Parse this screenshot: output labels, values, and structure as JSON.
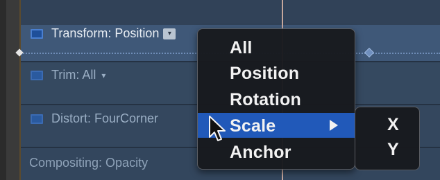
{
  "tracks": {
    "transform": {
      "label": "Transform: Position",
      "arrow": "▾"
    },
    "trim": {
      "label": "Trim: All",
      "arrow": "▾"
    },
    "distort": {
      "label": "Distort: FourCorner"
    },
    "compositing": {
      "label": "Compositing: Opacity"
    }
  },
  "menu": {
    "items": [
      {
        "label": "All"
      },
      {
        "label": "Position"
      },
      {
        "label": "Rotation"
      },
      {
        "label": "Scale",
        "highlighted": true,
        "has_submenu": true
      },
      {
        "label": "Anchor"
      }
    ],
    "submenu": [
      {
        "label": "X"
      },
      {
        "label": "Y"
      }
    ]
  },
  "colors": {
    "highlight": "#2159b9",
    "playhead": "#e0b9a8",
    "checkbox": "#1e4f9a"
  },
  "icons": {
    "cursor": "arrow-pointer",
    "submenu_indicator": "triangle-right"
  }
}
